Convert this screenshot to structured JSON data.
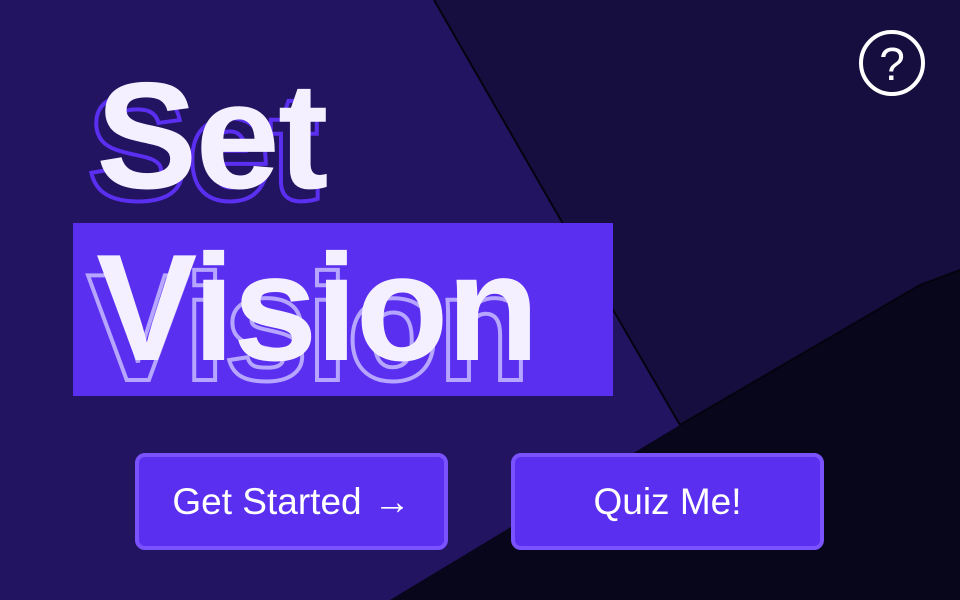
{
  "colors": {
    "panel_left": "#231462",
    "panel_right": "#160e3e",
    "panel_bottom": "#08061a",
    "accent": "#5a2ff0",
    "accent_border": "#7b52ff",
    "title_text": "#f4f0ff",
    "outline_light": "#b7a6ff"
  },
  "header": {
    "help_icon": "question-circle-icon",
    "help_symbol": "?"
  },
  "title": {
    "line1": "Set",
    "line2": "Vision"
  },
  "actions": {
    "get_started_label": "Get Started",
    "get_started_arrow": "→",
    "quiz_label": "Quiz Me!"
  }
}
